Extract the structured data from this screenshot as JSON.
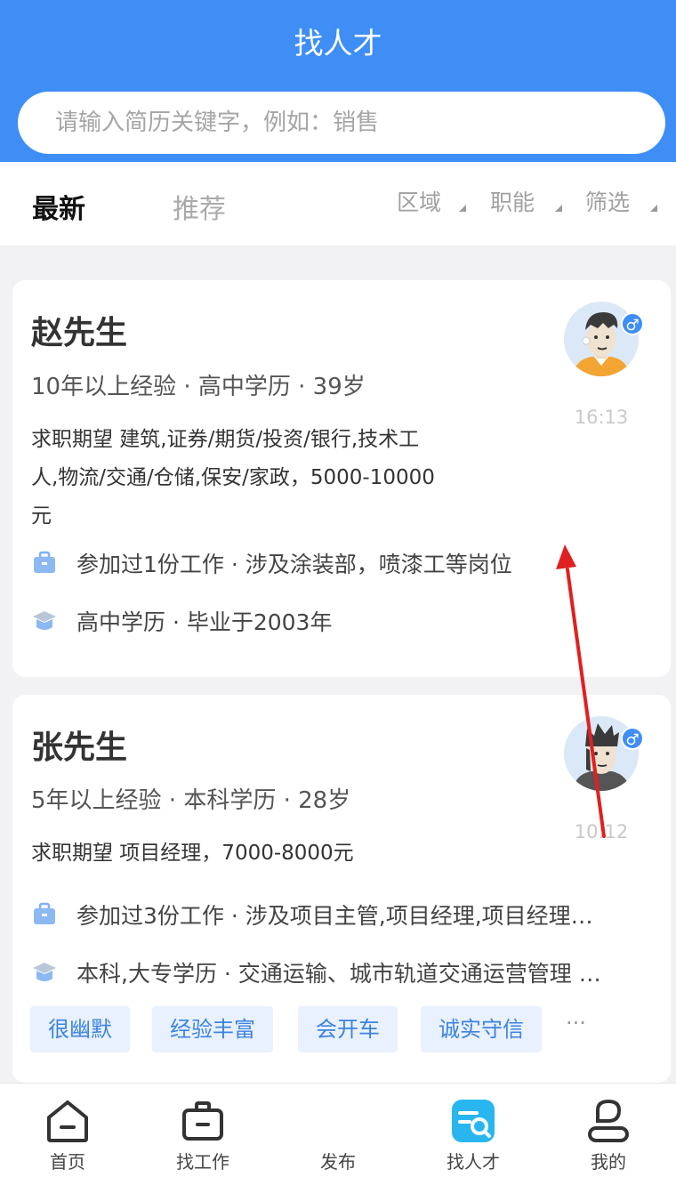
{
  "header": {
    "title": "找人才"
  },
  "search": {
    "placeholder": "请输入简历关键字，例如：销售"
  },
  "tabs": [
    {
      "label": "最新",
      "active": true
    },
    {
      "label": "推荐",
      "active": false
    }
  ],
  "filters": [
    {
      "label": "区域"
    },
    {
      "label": "职能"
    },
    {
      "label": "筛选"
    }
  ],
  "candidates": [
    {
      "name": "赵先生",
      "meta": "10年以上经验 · 高中学历 · 39岁",
      "expectation_lines": [
        "求职期望 建筑,证券/期货/投资/银行,技术工",
        "人,物流/交通/仓储,保安/家政，5000-10000",
        "元"
      ],
      "gender": "♂",
      "time": "16:13",
      "work": "参加过1份工作 · 涉及涂装部，喷漆工等岗位",
      "education": "高中学历 · 毕业于2003年",
      "tags": []
    },
    {
      "name": "张先生",
      "meta": "5年以上经验 · 本科学历 · 28岁",
      "expectation_lines": [
        "求职期望 项目经理，7000-8000元"
      ],
      "gender": "♂",
      "time": "10:12",
      "work": "参加过3份工作 · 涉及项目主管,项目经理,项目经理…",
      "education": "本科,大专学历 · 交通运输、城市轨道交通运营管理 …",
      "tags": [
        "很幽默",
        "经验丰富",
        "会开车",
        "诚实守信"
      ],
      "more": "···"
    }
  ],
  "bottom_nav": [
    {
      "label": "首页",
      "icon": "home-icon"
    },
    {
      "label": "找工作",
      "icon": "briefcase-icon"
    },
    {
      "label": "发布",
      "icon": "publish-icon"
    },
    {
      "label": "找人才",
      "icon": "find-talent-icon",
      "active": true
    },
    {
      "label": "我的",
      "icon": "user-icon"
    }
  ],
  "colors": {
    "brand": "#3e8ef5",
    "active_nav": "#29b6f0",
    "tag_bg": "#e8f1fd",
    "tag_text": "#3c83e0",
    "arrow": "#e02020"
  }
}
